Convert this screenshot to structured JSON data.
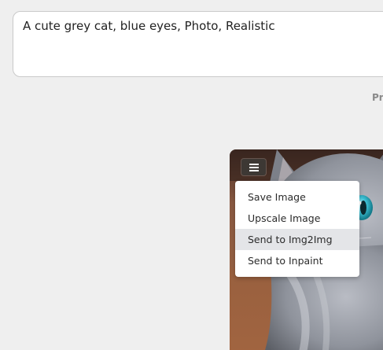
{
  "prompt": {
    "value": "A cute grey cat, blue eyes, Photo, Realistic"
  },
  "partial_label": "Pr",
  "image_card": {
    "icon": "cat-photo",
    "menu_button_icon": "hamburger-icon",
    "menu": {
      "items": [
        {
          "label": "Save Image"
        },
        {
          "label": "Upscale Image"
        },
        {
          "label": "Send to Img2Img",
          "active": true
        },
        {
          "label": "Send to Inpaint"
        }
      ]
    }
  },
  "colors": {
    "background": "#efefef",
    "menu_button": "#3d3834",
    "menu_highlight": "#e4e5e8"
  }
}
